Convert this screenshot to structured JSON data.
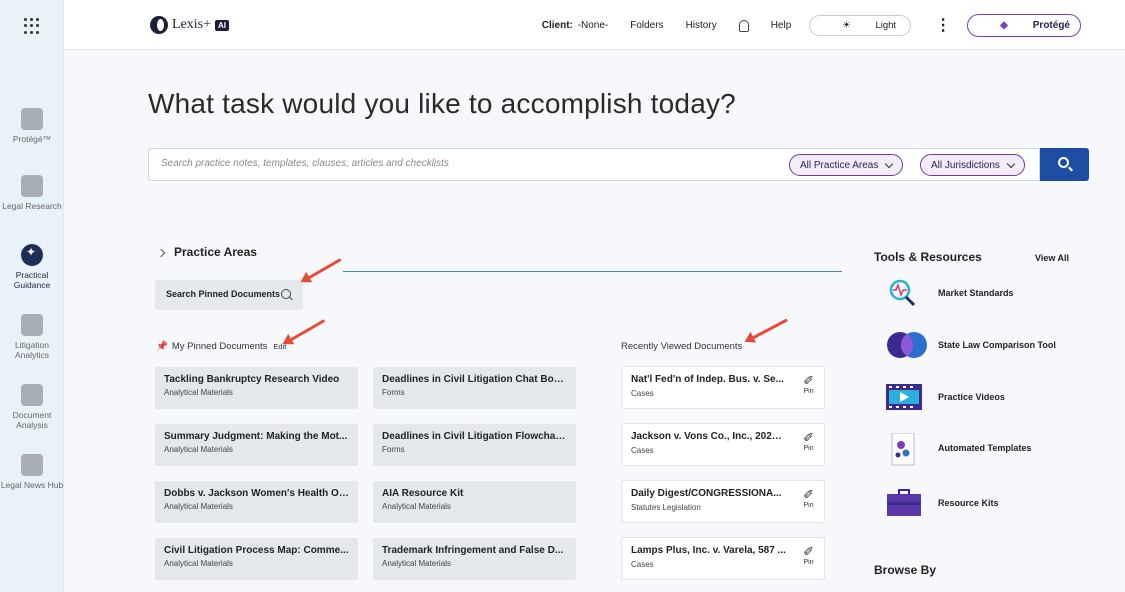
{
  "rail": {
    "items": [
      {
        "label": "Protégé™"
      },
      {
        "label": "Legal Research"
      },
      {
        "label": "Practical Guidance"
      },
      {
        "label": "Litigation Analytics"
      },
      {
        "label": "Document Analysis"
      },
      {
        "label": "Legal News Hub"
      }
    ]
  },
  "header": {
    "logo_text": "Lexis+",
    "logo_badge": "AI",
    "client": "Client:",
    "client_value": "-None-",
    "folders": "Folders",
    "history": "History",
    "help": "Help",
    "theme": "Light",
    "protege": "Protégé"
  },
  "main": {
    "heading": "What task would you like to accomplish today?",
    "search_placeholder": "Search practice notes, templates, clauses, articles and checklists",
    "filter_areas": "All Practice Areas",
    "filter_jurisdictions": "All Jurisdictions",
    "practice_areas": "Practice Areas",
    "search_pinned": "Search Pinned Documents",
    "pinned_label": "My Pinned Documents",
    "edit": "Edit",
    "recent_label": "Recently Viewed Documents",
    "pinned": [
      {
        "title": "Tackling Bankruptcy Research Video",
        "type": "Analytical Materials"
      },
      {
        "title": "Deadlines in Civil Litigation Chat Bot ...",
        "type": "Forms"
      },
      {
        "title": "Summary Judgment: Making the Mot...",
        "type": "Analytical Materials"
      },
      {
        "title": "Deadlines in Civil Litigation Flowchar...",
        "type": "Forms"
      },
      {
        "title": "Dobbs v. Jackson Women's Health Or...",
        "type": "Analytical Materials"
      },
      {
        "title": "AIA Resource Kit",
        "type": "Analytical Materials"
      },
      {
        "title": "Civil Litigation Process Map: Comme...",
        "type": "Analytical Materials"
      },
      {
        "title": "Trademark Infringement and False D...",
        "type": "Analytical Materials"
      }
    ],
    "recent": [
      {
        "title": "Nat'l Fed'n of Indep. Bus. v. Se...",
        "type": "Cases",
        "pin": "Pin"
      },
      {
        "title": "Jackson v. Vons Co., Inc., 2024 ...",
        "type": "Cases",
        "pin": "Pin"
      },
      {
        "title": "Daily Digest/CONGRESSIONA...",
        "type": "Statutes Legislation",
        "pin": "Pin"
      },
      {
        "title": "Lamps Plus, Inc. v. Varela, 587 ...",
        "type": "Cases",
        "pin": "Pin"
      }
    ]
  },
  "tools": {
    "heading": "Tools & Resources",
    "view_all": "View All",
    "items": [
      {
        "label": "Market Standards"
      },
      {
        "label": "State Law Comparison Tool"
      },
      {
        "label": "Practice Videos"
      },
      {
        "label": "Automated Templates"
      },
      {
        "label": "Resource Kits"
      }
    ],
    "browse_by": "Browse By"
  },
  "colors": {
    "accent": "#1d4ea3",
    "purple": "#7a3fc2",
    "annotation_arrow": "#e84a3a"
  }
}
